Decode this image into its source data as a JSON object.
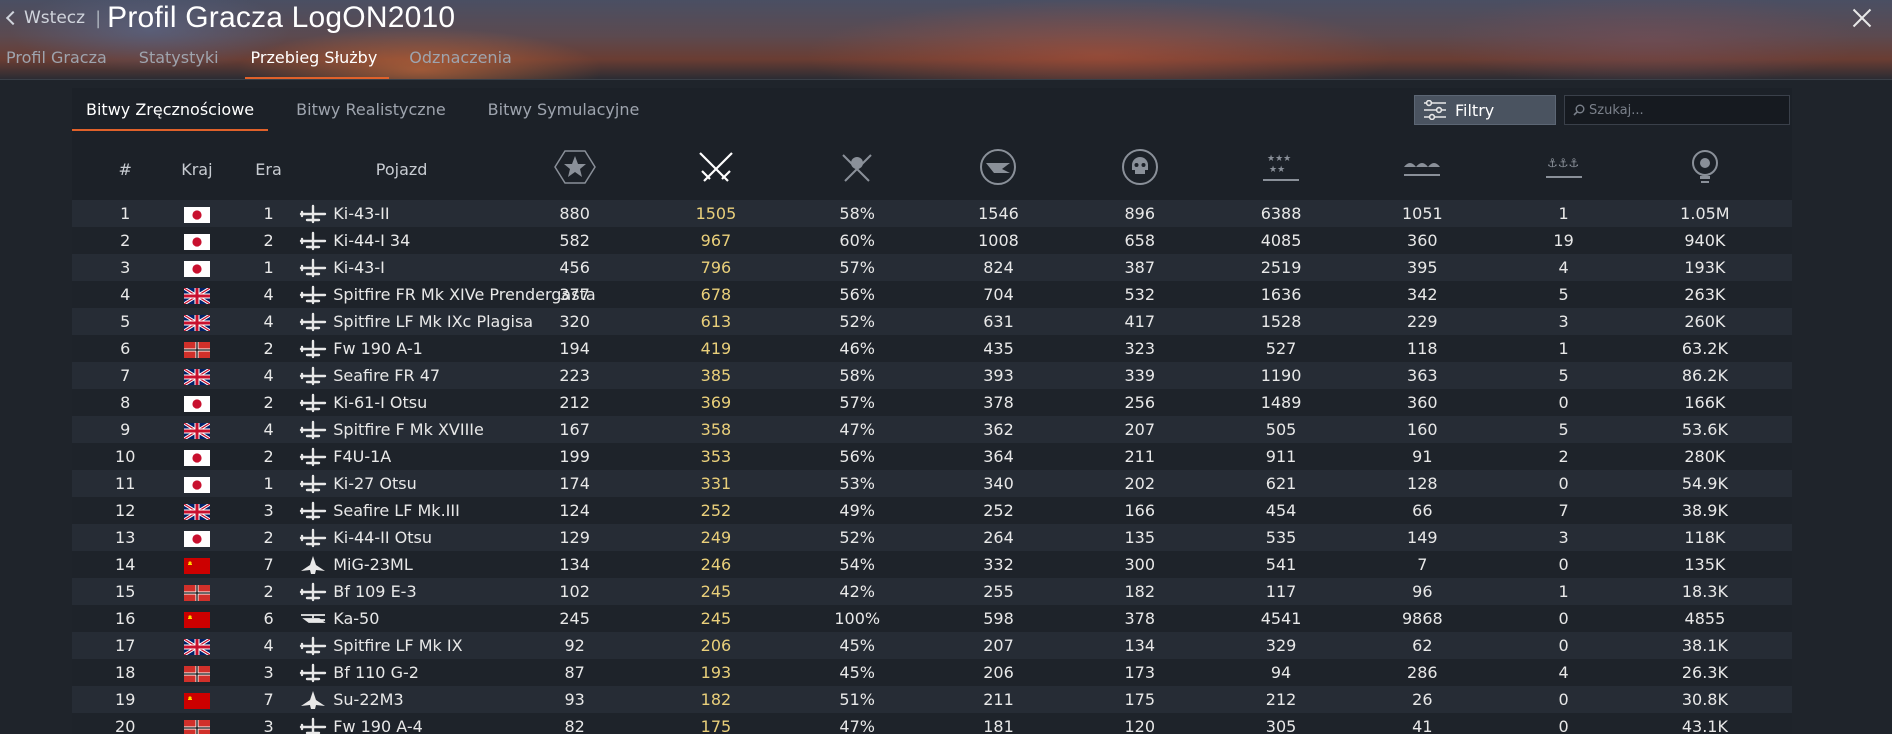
{
  "header": {
    "back_label": "Wstecz",
    "title": "Profil Gracza LogON2010"
  },
  "tabs": [
    {
      "label": "Profil Gracza",
      "active": false
    },
    {
      "label": "Statystyki",
      "active": false
    },
    {
      "label": "Przebieg Służby",
      "active": true
    },
    {
      "label": "Odznaczenia",
      "active": false
    }
  ],
  "subtabs": [
    {
      "label": "Bitwy Zręcznościowe",
      "active": true
    },
    {
      "label": "Bitwy Realistyczne",
      "active": false
    },
    {
      "label": "Bitwy Symulacyjne",
      "active": false
    }
  ],
  "filters": {
    "label": "Filtry"
  },
  "search": {
    "placeholder": "Szukaj..."
  },
  "columns": {
    "rank": "#",
    "country": "Kraj",
    "era": "Era",
    "vehicle": "Pojazd",
    "icon_columns": [
      "battles-icon",
      "victories-icon",
      "win-rate-icon",
      "respawns-icon",
      "deaths-icon",
      "air-kills-icon",
      "ground-kills-icon",
      "naval-kills-icon",
      "experience-icon"
    ]
  },
  "rows": [
    {
      "n": "1",
      "country": "japan",
      "era": "1",
      "vehicle": "Ki-43-II",
      "type": "plane",
      "c1": "880",
      "c2": "1505",
      "c3": "58%",
      "c4": "1546",
      "c5": "896",
      "c6": "6388",
      "c7": "1051",
      "c8": "1",
      "c9": "1.05M"
    },
    {
      "n": "2",
      "country": "japan",
      "era": "2",
      "vehicle": "Ki-44-I 34",
      "type": "plane",
      "c1": "582",
      "c2": "967",
      "c3": "60%",
      "c4": "1008",
      "c5": "658",
      "c6": "4085",
      "c7": "360",
      "c8": "19",
      "c9": "940K"
    },
    {
      "n": "3",
      "country": "japan",
      "era": "1",
      "vehicle": "Ki-43-I",
      "type": "plane",
      "c1": "456",
      "c2": "796",
      "c3": "57%",
      "c4": "824",
      "c5": "387",
      "c6": "2519",
      "c7": "395",
      "c8": "4",
      "c9": "193K"
    },
    {
      "n": "4",
      "country": "uk",
      "era": "4",
      "vehicle": "Spitfire FR Mk XIVe Prendergasta",
      "type": "plane",
      "c1": "377",
      "c2": "678",
      "c3": "56%",
      "c4": "704",
      "c5": "532",
      "c6": "1636",
      "c7": "342",
      "c8": "5",
      "c9": "263K"
    },
    {
      "n": "5",
      "country": "uk",
      "era": "4",
      "vehicle": "Spitfire LF Mk IXc Plagisa",
      "type": "plane",
      "c1": "320",
      "c2": "613",
      "c3": "52%",
      "c4": "631",
      "c5": "417",
      "c6": "1528",
      "c7": "229",
      "c8": "3",
      "c9": "260K"
    },
    {
      "n": "6",
      "country": "germany",
      "era": "2",
      "vehicle": "Fw 190 A-1",
      "type": "plane",
      "c1": "194",
      "c2": "419",
      "c3": "46%",
      "c4": "435",
      "c5": "323",
      "c6": "527",
      "c7": "118",
      "c8": "1",
      "c9": "63.2K"
    },
    {
      "n": "7",
      "country": "uk",
      "era": "4",
      "vehicle": "Seafire FR 47",
      "type": "plane",
      "c1": "223",
      "c2": "385",
      "c3": "58%",
      "c4": "393",
      "c5": "339",
      "c6": "1190",
      "c7": "363",
      "c8": "5",
      "c9": "86.2K"
    },
    {
      "n": "8",
      "country": "japan",
      "era": "2",
      "vehicle": "Ki-61-I Otsu",
      "type": "plane",
      "c1": "212",
      "c2": "369",
      "c3": "57%",
      "c4": "378",
      "c5": "256",
      "c6": "1489",
      "c7": "360",
      "c8": "0",
      "c9": "166K"
    },
    {
      "n": "9",
      "country": "uk",
      "era": "4",
      "vehicle": "Spitfire F Mk XVIIIe",
      "type": "plane",
      "c1": "167",
      "c2": "358",
      "c3": "47%",
      "c4": "362",
      "c5": "207",
      "c6": "505",
      "c7": "160",
      "c8": "5",
      "c9": "53.6K"
    },
    {
      "n": "10",
      "country": "japan",
      "era": "2",
      "vehicle": "F4U-1A",
      "type": "plane-jp",
      "c1": "199",
      "c2": "353",
      "c3": "56%",
      "c4": "364",
      "c5": "211",
      "c6": "911",
      "c7": "91",
      "c8": "2",
      "c9": "280K"
    },
    {
      "n": "11",
      "country": "japan",
      "era": "1",
      "vehicle": "Ki-27 Otsu",
      "type": "plane",
      "c1": "174",
      "c2": "331",
      "c3": "53%",
      "c4": "340",
      "c5": "202",
      "c6": "621",
      "c7": "128",
      "c8": "0",
      "c9": "54.9K"
    },
    {
      "n": "12",
      "country": "uk",
      "era": "3",
      "vehicle": "Seafire LF Mk.III",
      "type": "plane",
      "c1": "124",
      "c2": "252",
      "c3": "49%",
      "c4": "252",
      "c5": "166",
      "c6": "454",
      "c7": "66",
      "c8": "7",
      "c9": "38.9K"
    },
    {
      "n": "13",
      "country": "japan",
      "era": "2",
      "vehicle": "Ki-44-II Otsu",
      "type": "plane",
      "c1": "129",
      "c2": "249",
      "c3": "52%",
      "c4": "264",
      "c5": "135",
      "c6": "535",
      "c7": "149",
      "c8": "3",
      "c9": "118K"
    },
    {
      "n": "14",
      "country": "ussr",
      "era": "7",
      "vehicle": "MiG-23ML",
      "type": "jet",
      "c1": "134",
      "c2": "246",
      "c3": "54%",
      "c4": "332",
      "c5": "300",
      "c6": "541",
      "c7": "7",
      "c8": "0",
      "c9": "135K"
    },
    {
      "n": "15",
      "country": "germany",
      "era": "2",
      "vehicle": "Bf 109 E-3",
      "type": "plane",
      "c1": "102",
      "c2": "245",
      "c3": "42%",
      "c4": "255",
      "c5": "182",
      "c6": "117",
      "c7": "96",
      "c8": "1",
      "c9": "18.3K"
    },
    {
      "n": "16",
      "country": "ussr",
      "era": "6",
      "vehicle": "Ka-50",
      "type": "heli",
      "c1": "245",
      "c2": "245",
      "c3": "100%",
      "c4": "598",
      "c5": "378",
      "c6": "4541",
      "c7": "9868",
      "c8": "0",
      "c9": "4855"
    },
    {
      "n": "17",
      "country": "uk",
      "era": "4",
      "vehicle": "Spitfire LF Mk IX",
      "type": "plane",
      "c1": "92",
      "c2": "206",
      "c3": "45%",
      "c4": "207",
      "c5": "134",
      "c6": "329",
      "c7": "62",
      "c8": "0",
      "c9": "38.1K"
    },
    {
      "n": "18",
      "country": "germany",
      "era": "3",
      "vehicle": "Bf 110 G-2",
      "type": "plane",
      "c1": "87",
      "c2": "193",
      "c3": "45%",
      "c4": "206",
      "c5": "173",
      "c6": "94",
      "c7": "286",
      "c8": "4",
      "c9": "26.3K"
    },
    {
      "n": "19",
      "country": "ussr",
      "era": "7",
      "vehicle": "Su-22M3",
      "type": "jet",
      "c1": "93",
      "c2": "182",
      "c3": "51%",
      "c4": "211",
      "c5": "175",
      "c6": "212",
      "c7": "26",
      "c8": "0",
      "c9": "30.8K"
    },
    {
      "n": "20",
      "country": "germany",
      "era": "3",
      "vehicle": "Fw 190 A-4",
      "type": "plane",
      "c1": "82",
      "c2": "175",
      "c3": "47%",
      "c4": "181",
      "c5": "120",
      "c6": "305",
      "c7": "41",
      "c8": "0",
      "c9": "43.1K"
    }
  ],
  "colors": {
    "accent": "#e0612a",
    "highlight": "#e9cf7a"
  }
}
